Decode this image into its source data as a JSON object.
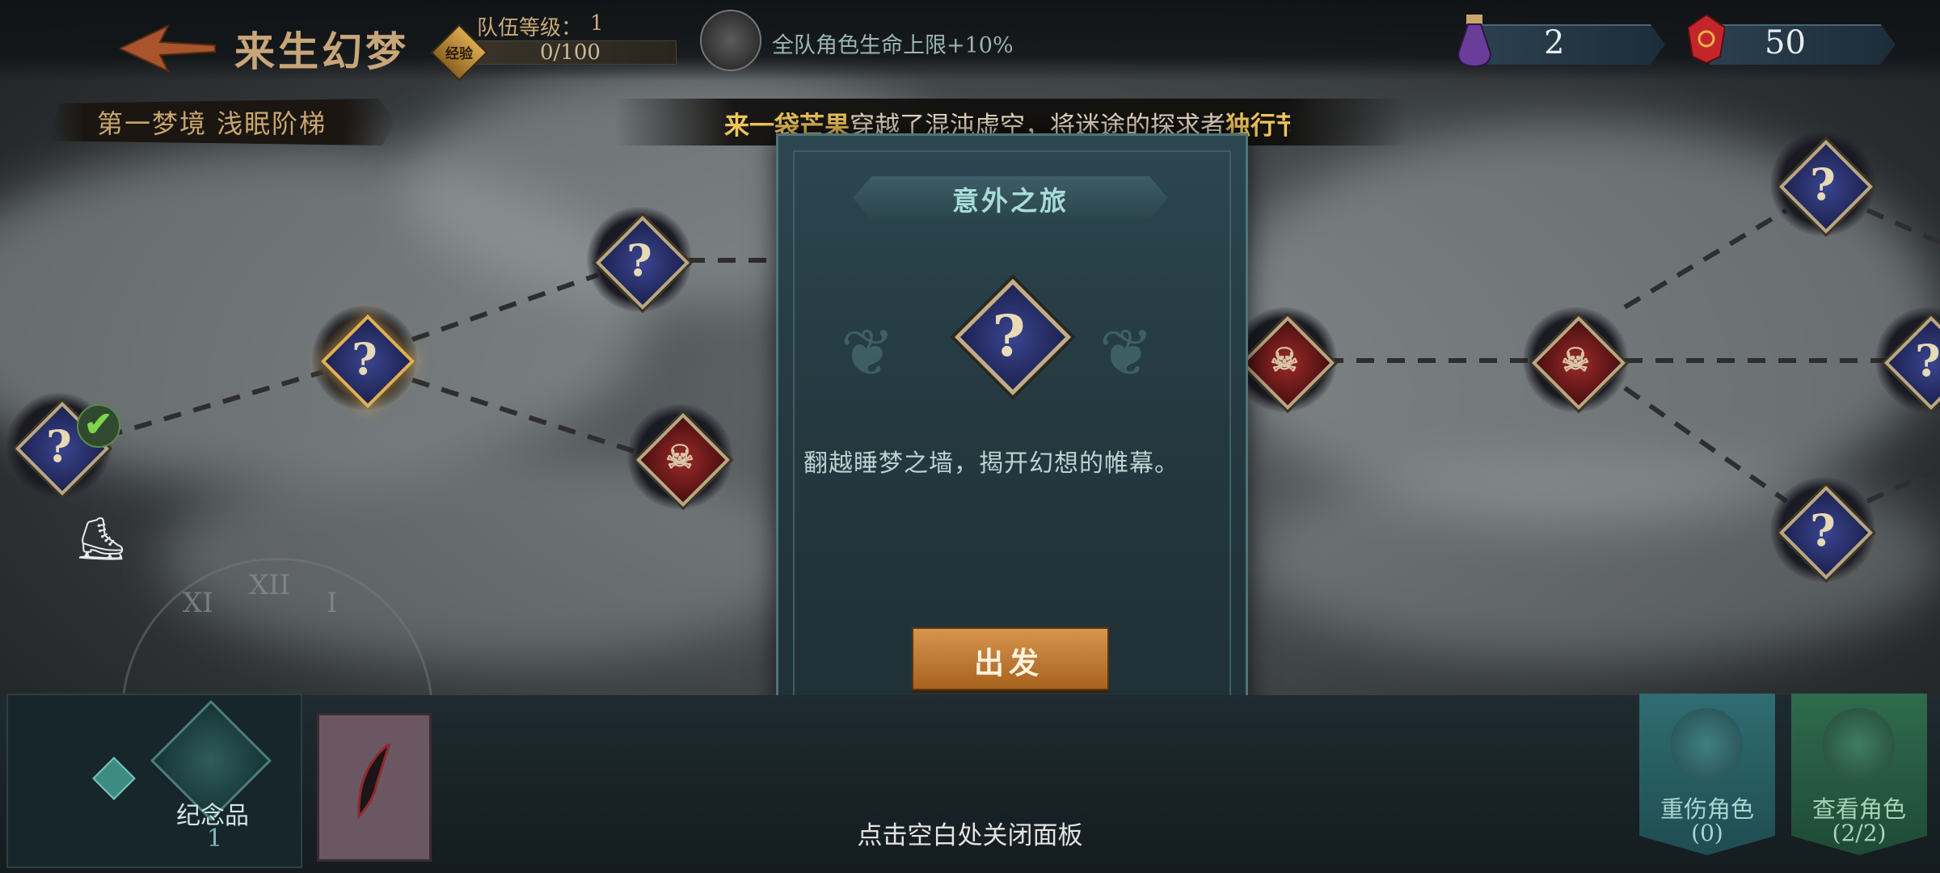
{
  "header": {
    "title": "来生幻梦",
    "team_level_label": "队伍等级：",
    "team_level_value": "1",
    "exp_badge": "经验",
    "exp_value": "0/100",
    "buff_text": "全队角色生命上限+10%",
    "resource_potion": "2",
    "resource_gem": "50"
  },
  "stage": {
    "name": "第一梦境  浅眠阶梯"
  },
  "ticker": {
    "part1": "来一袋芒果",
    "part2": "穿越了混沌虚空，将迷途的探求者",
    "part3": "独行节"
  },
  "map": {
    "nodes": [
      {
        "type": "mystery",
        "glyph": "?"
      },
      {
        "type": "mystery",
        "glyph": "?"
      },
      {
        "type": "mystery",
        "glyph": "?"
      },
      {
        "type": "enemy",
        "glyph": "☠"
      },
      {
        "type": "enemy",
        "glyph": "☠"
      },
      {
        "type": "enemy",
        "glyph": "☠"
      },
      {
        "type": "mystery",
        "glyph": "?"
      },
      {
        "type": "mystery",
        "glyph": "?"
      },
      {
        "type": "mystery",
        "glyph": "?"
      }
    ],
    "clock_numerals": [
      "XI",
      "XII",
      "I"
    ]
  },
  "panel": {
    "title": "意外之旅",
    "event_glyph": "?",
    "description": "翻越睡梦之墙，揭开幻想的帷幕。",
    "go_button": "出发"
  },
  "bottom": {
    "souvenir_label": "纪念品",
    "souvenir_count": "1",
    "close_hint": "点击空白处关闭面板",
    "injured_label": "重伤角色",
    "injured_count": "(0)",
    "view_label": "查看角色",
    "view_count": "(2/2)"
  },
  "colors": {
    "accent_gold": "#c8a67a",
    "panel_teal": "#2c4650",
    "go_button": "#d6954e",
    "injured_btn": "#2f6d72",
    "view_btn": "#2f6b4d"
  },
  "icons": [
    "back-arrow-icon",
    "exp-badge-icon",
    "buff-emblem-icon",
    "potion-icon",
    "gem-icon",
    "check-icon",
    "boot-icon",
    "souvenir-bag-icon",
    "feather-item-icon",
    "axe-icon",
    "hood-icon"
  ]
}
